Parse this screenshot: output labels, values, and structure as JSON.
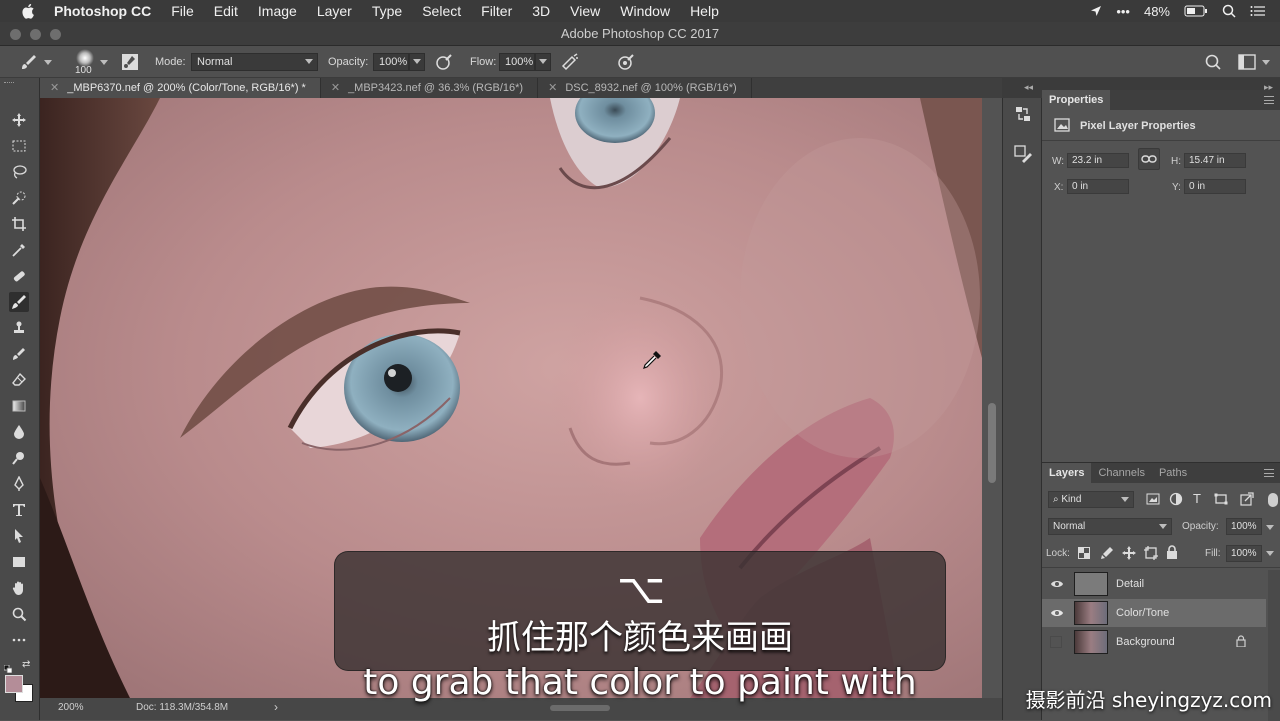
{
  "menubar": {
    "app_name": "Photoshop CC",
    "items": [
      "File",
      "Edit",
      "Image",
      "Layer",
      "Type",
      "Select",
      "Filter",
      "3D",
      "View",
      "Window",
      "Help"
    ],
    "more": "•••",
    "battery": "48%"
  },
  "window": {
    "title": "Adobe Photoshop CC 2017"
  },
  "options": {
    "brush_size": "100",
    "mode_label": "Mode:",
    "mode_value": "Normal",
    "opacity_label": "Opacity:",
    "opacity_value": "100%",
    "flow_label": "Flow:",
    "flow_value": "100%"
  },
  "doc_tabs": [
    {
      "label": "_MBP6370.nef @ 200% (Color/Tone, RGB/16*) *",
      "active": true
    },
    {
      "label": "_MBP3423.nef @ 36.3% (RGB/16*)",
      "active": false
    },
    {
      "label": "DSC_8932.nef @ 100% (RGB/16*)",
      "active": false
    }
  ],
  "status": {
    "zoom": "200%",
    "doc": "Doc: 118.3M/354.8M",
    "arrow": "›"
  },
  "properties": {
    "tab": "Properties",
    "section": "Pixel Layer Properties",
    "w_label": "W:",
    "w_value": "23.2 in",
    "h_label": "H:",
    "h_value": "15.47 in",
    "x_label": "X:",
    "x_value": "0 in",
    "y_label": "Y:",
    "y_value": "0 in"
  },
  "layers_panel": {
    "tabs": [
      "Layers",
      "Channels",
      "Paths"
    ],
    "filter_kind": "Kind",
    "blend_mode": "Normal",
    "opacity_label": "Opacity:",
    "opacity_value": "100%",
    "lock_label": "Lock:",
    "fill_label": "Fill:",
    "fill_value": "100%",
    "layers": [
      {
        "name": "Detail",
        "visible": true,
        "selected": false
      },
      {
        "name": "Color/Tone",
        "visible": true,
        "selected": true
      },
      {
        "name": "Background",
        "visible": false,
        "selected": false
      }
    ]
  },
  "subtitles": {
    "shortcut": "⌥",
    "chinese": "抓住那个颜色来画画",
    "english": "to grab that color to paint with"
  },
  "watermark": "摄影前沿 sheyingzyz.com",
  "colors": {
    "accent_selected_layer": "#6b6b6b",
    "canvas_skin": "#b58886",
    "eye_iris": "#8fb0c0"
  }
}
